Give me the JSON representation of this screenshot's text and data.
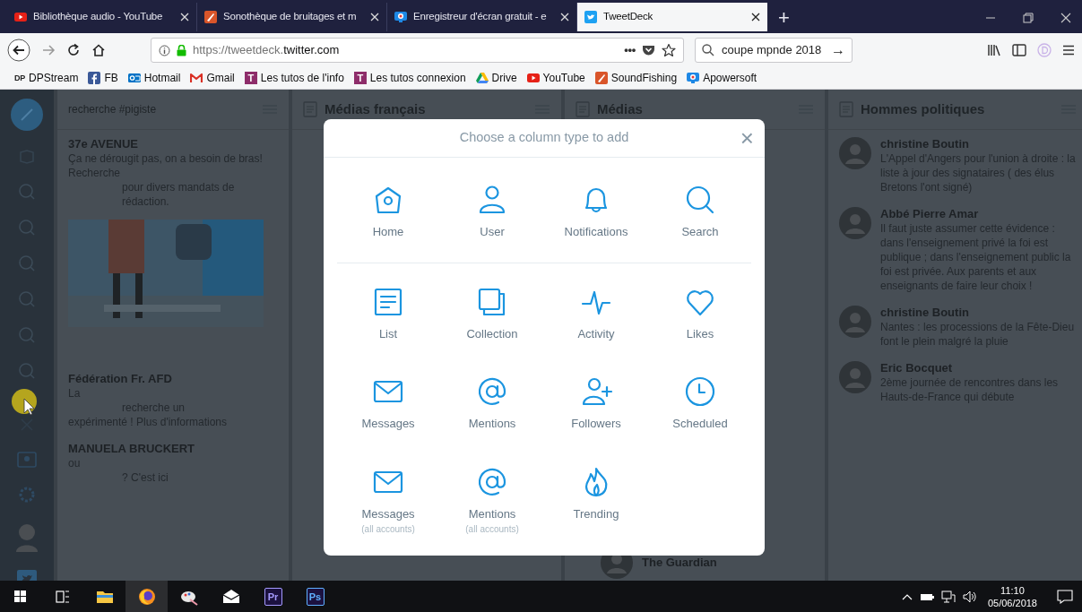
{
  "browser": {
    "tabs": [
      {
        "title": "Bibliothèque audio - YouTube",
        "kind": "youtube",
        "selected": false
      },
      {
        "title": "Sonothèque de bruitages et m",
        "kind": "sound",
        "selected": false
      },
      {
        "title": "Enregistreur d'écran gratuit - e",
        "kind": "recorder",
        "selected": false
      },
      {
        "title": "TweetDeck",
        "kind": "bird",
        "selected": true
      }
    ],
    "new_tab": "+",
    "url_host": "https://tweetdeck.",
    "url_domain": "twitter.com",
    "page_actions": "•••",
    "search_query": "coupe mpnde 2018",
    "search_go": "→",
    "bookmarks": [
      {
        "label": "DPStream",
        "kind": "dp",
        "badge": "DP"
      },
      {
        "label": "FB",
        "kind": "facebook"
      },
      {
        "label": "Hotmail",
        "kind": "outlook"
      },
      {
        "label": "Gmail",
        "kind": "gmail"
      },
      {
        "label": "Les tutos de l'info",
        "kind": "tutos",
        "badge": "T"
      },
      {
        "label": "Les tutos connexion",
        "kind": "tutos",
        "badge": "T"
      },
      {
        "label": "Drive",
        "kind": "drive"
      },
      {
        "label": "YouTube",
        "kind": "youtube"
      },
      {
        "label": "SoundFishing",
        "kind": "sound"
      },
      {
        "label": "Apowersoft",
        "kind": "recorder"
      }
    ]
  },
  "columns": [
    {
      "title": "recherche #pigiste",
      "kind": "search",
      "tweets": [
        {
          "author": "37e AVENUE",
          "text": "Ça ne dérougit pas, on a besoin de bras! Recherche",
          "more": "pour divers mandats de rédaction.",
          "picture": true
        },
        {
          "author": "Fédération Fr. AFD",
          "text": "La",
          "more": "recherche un",
          "extra": "expérimenté ! Plus d'informations"
        },
        {
          "author": "MANUELA BRUCKERT",
          "text": "ou",
          "more": "? C'est ici"
        }
      ]
    },
    {
      "title": "Médias français",
      "kind": "list"
    },
    {
      "title": "Médias",
      "kind": "list",
      "tweets": [
        {
          "author": "The Guardian",
          "bottom": true,
          "avatar": true
        }
      ]
    },
    {
      "title": "Hommes politiques",
      "kind": "list",
      "tweets": [
        {
          "author": "christine Boutin",
          "text": "L'Appel d'Angers pour l'union à droite : la liste à jour des signataires ( des élus Bretons l'ont signé)",
          "avatar": true
        },
        {
          "author": "Abbé Pierre Amar",
          "text": "Il faut juste assumer cette évidence : dans l'enseignement privé la foi est publique ; dans l'enseignement public la foi est privée. Aux parents et aux enseignants de faire leur choix !",
          "avatar": true
        },
        {
          "author": "christine Boutin",
          "text": "Nantes : les processions de la Fête-Dieu font le plein malgré la pluie",
          "avatar": true
        },
        {
          "author": "Eric Bocquet",
          "text": "2ème journée de rencontres dans les Hauts-de-France qui débute",
          "avatar": true
        }
      ]
    }
  ],
  "modal": {
    "title": "Choose a column type to add",
    "close": "×",
    "sections": [
      [
        {
          "kind": "home",
          "label": "Home"
        },
        {
          "kind": "user",
          "label": "User"
        },
        {
          "kind": "notifications",
          "label": "Notifications"
        },
        {
          "kind": "search",
          "label": "Search"
        }
      ],
      [
        {
          "kind": "list",
          "label": "List"
        },
        {
          "kind": "collection",
          "label": "Collection"
        },
        {
          "kind": "activity",
          "label": "Activity"
        },
        {
          "kind": "likes",
          "label": "Likes"
        },
        {
          "kind": "messages",
          "label": "Messages"
        },
        {
          "kind": "mentions",
          "label": "Mentions"
        },
        {
          "kind": "followers",
          "label": "Followers"
        },
        {
          "kind": "scheduled",
          "label": "Scheduled"
        },
        {
          "kind": "messages",
          "label": "Messages",
          "sublabel": "(all accounts)"
        },
        {
          "kind": "mentions",
          "label": "Mentions",
          "sublabel": "(all accounts)"
        },
        {
          "kind": "trending",
          "label": "Trending"
        }
      ]
    ]
  },
  "taskbar": {
    "apps": [
      {
        "kind": "taskview"
      },
      {
        "kind": "explorer"
      },
      {
        "kind": "firefox"
      },
      {
        "kind": "paint"
      },
      {
        "kind": "mail"
      },
      {
        "kind": "badge",
        "badge": "Pr",
        "color": "#a59aff"
      },
      {
        "kind": "badge",
        "badge": "Ps",
        "color": "#5fb0ff"
      }
    ],
    "time": "11:10",
    "date": "05/06/2018"
  }
}
